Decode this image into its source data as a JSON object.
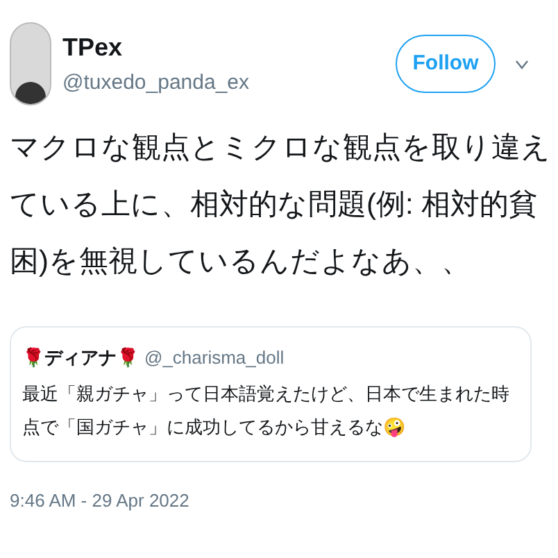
{
  "author": {
    "name": "TPex",
    "handle": "@tuxedo_panda_ex"
  },
  "follow_button": "Follow",
  "tweet_text": "マクロな観点とミクロな観点を取り違えている上に、相対的な問題(例: 相対的貧困)を無視しているんだよなあ、、",
  "quoted_tweet": {
    "name": "🌹ディアナ🌹",
    "handle": "@_charisma_doll",
    "text": "最近「親ガチャ」って日本語覚えたけど、日本で生まれた時点で「国ガチャ」に成功してるから甘えるな🤪"
  },
  "timestamp": "9:46 AM - 29 Apr 2022"
}
